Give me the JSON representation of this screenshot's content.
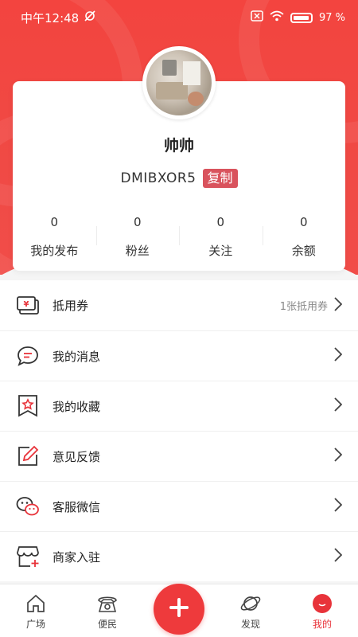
{
  "status_bar": {
    "time": "中午12:48",
    "battery": "97"
  },
  "profile": {
    "username": "帅帅",
    "code": "DMIBXOR5",
    "copy_label": "复制",
    "stats": [
      {
        "value": "0",
        "label": "我的发布"
      },
      {
        "value": "0",
        "label": "粉丝"
      },
      {
        "value": "0",
        "label": "关注"
      },
      {
        "value": "0",
        "label": "余额"
      }
    ]
  },
  "menu": [
    {
      "label": "抵用券",
      "icon": "coupon-icon",
      "right_text": "1张抵用券"
    },
    {
      "label": "我的消息",
      "icon": "message-icon",
      "right_text": ""
    },
    {
      "label": "我的收藏",
      "icon": "favorite-icon",
      "right_text": ""
    },
    {
      "label": "意见反馈",
      "icon": "feedback-icon",
      "right_text": ""
    },
    {
      "label": "客服微信",
      "icon": "wechat-icon",
      "right_text": ""
    },
    {
      "label": "商家入驻",
      "icon": "store-icon",
      "right_text": ""
    }
  ],
  "bottom_nav": {
    "items": [
      {
        "label": "广场",
        "icon": "home-icon"
      },
      {
        "label": "便民",
        "icon": "phone-icon"
      },
      {
        "label": "发现",
        "icon": "planet-icon"
      },
      {
        "label": "我的",
        "icon": "profile-icon"
      }
    ],
    "active_index": 3,
    "fab_icon": "plus-icon"
  },
  "colors": {
    "brand_red": "#f14442",
    "copy_badge": "#d9535d",
    "active_nav": "#e8333a"
  }
}
